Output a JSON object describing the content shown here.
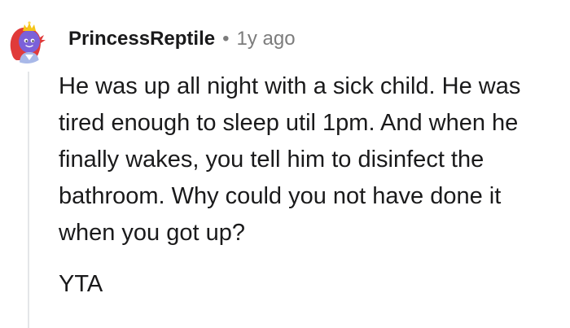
{
  "comment": {
    "author": "PrincessReptile",
    "separator": "•",
    "age": "1y ago",
    "avatar_icon": "princess-dinosaur-avatar-icon",
    "body": "He was up all night with a sick child. He was tired enough to sleep util 1pm. And when he finally wakes, you tell him to disinfect the bathroom. Why could you not have done it when you got up?",
    "verdict": "YTA"
  },
  "colors": {
    "text": "#1a1a1b",
    "meta": "#7c7c7c",
    "thread_line": "#e4e6e8",
    "avatar_primary": "#7b61d9",
    "avatar_hair": "#e03a3a",
    "avatar_crown": "#f5c518"
  }
}
